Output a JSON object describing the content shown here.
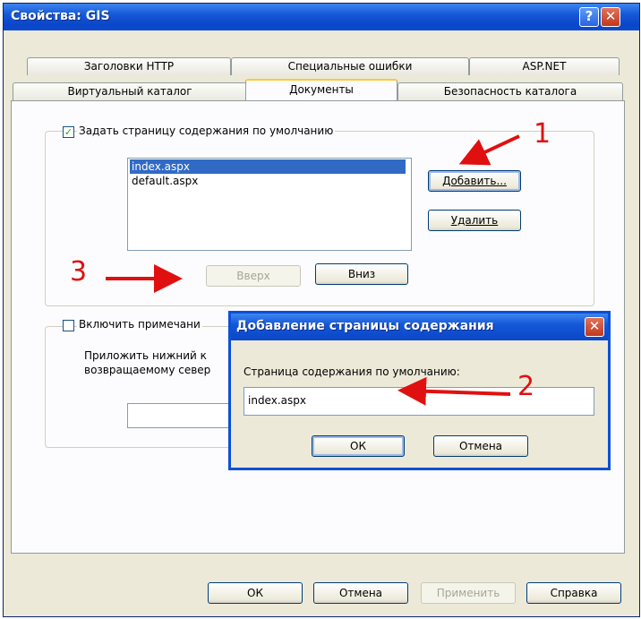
{
  "window": {
    "title": "Свойства: GIS",
    "help_glyph": "?",
    "close_glyph": "✕"
  },
  "tabs": {
    "row1": [
      "Заголовки HTTP",
      "Специальные ошибки",
      "ASP.NET"
    ],
    "row2": [
      "Виртуальный каталог",
      "Документы",
      "Безопасность каталога"
    ]
  },
  "documents": {
    "default_page_checkbox": "Задать страницу содержания по умолчанию",
    "default_page_checked": true,
    "pages": [
      "index.aspx",
      "default.aspx"
    ],
    "add_button": "Добавить...",
    "remove_button": "Удалить",
    "up_button": "Вверх",
    "down_button": "Вниз",
    "footer_checkbox": "Включить примечани",
    "footer_checked": false,
    "footer_desc_line1": "Приложить нижний к",
    "footer_desc_line2": "возвращаемому север"
  },
  "dialog": {
    "title": "Добавление страницы содержания",
    "field_label": "Страница содержания по умолчанию:",
    "field_value": "index.aspx",
    "ok": "ОК",
    "cancel": "Отмена"
  },
  "bottom_buttons": {
    "ok": "ОК",
    "cancel": "Отмена",
    "apply": "Применить",
    "help": "Справка"
  },
  "annotations": [
    "1",
    "2",
    "3"
  ],
  "colors": {
    "arrow": "#e01010",
    "titlebar": "#0a46c8",
    "selection": "#316ac5"
  }
}
